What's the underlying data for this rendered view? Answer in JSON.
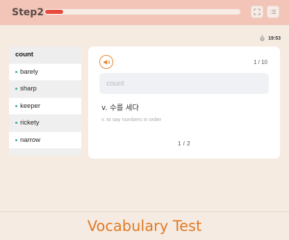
{
  "header": {
    "brand": "Step2",
    "progress_fraction": 0.1
  },
  "timer": {
    "value": "19:53"
  },
  "word_list": {
    "items": [
      {
        "label": "count",
        "active": true
      },
      {
        "label": "barely",
        "active": false
      },
      {
        "label": "sharp",
        "active": false
      },
      {
        "label": "keeper",
        "active": false
      },
      {
        "label": "rickety",
        "active": false
      },
      {
        "label": "narrow",
        "active": false
      },
      {
        "label": "",
        "active": false
      }
    ]
  },
  "card": {
    "speaker_icon": "speaker-icon",
    "question_count": "1 / 10",
    "answer_value": "",
    "answer_placeholder": "count",
    "meaning": "v. 수를 세다",
    "definition": "v. to say numbers in order",
    "pager": "1 / 2"
  },
  "caption": "Vocabulary Test",
  "colors": {
    "topbar": "#f2c5b8",
    "progress": "#e84a3c",
    "accent": "#e8862b",
    "caption": "#e07a23"
  }
}
